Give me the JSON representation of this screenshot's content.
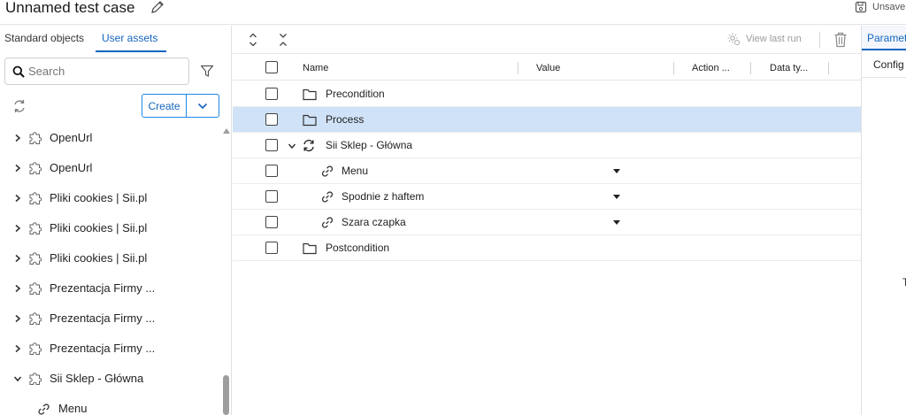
{
  "header": {
    "title": "Unnamed test case",
    "unsaved_label": "Unsave"
  },
  "left_panel": {
    "tabs": [
      {
        "label": "Standard objects",
        "active": false
      },
      {
        "label": "User assets",
        "active": true
      }
    ],
    "search": {
      "placeholder": "Search",
      "value": ""
    },
    "create_label": "Create",
    "tree": [
      {
        "label": "OpenUrl",
        "expanded": false,
        "child": false
      },
      {
        "label": "OpenUrl",
        "expanded": false,
        "child": false
      },
      {
        "label": "Pliki cookies | Sii.pl",
        "expanded": false,
        "child": false
      },
      {
        "label": "Pliki cookies | Sii.pl",
        "expanded": false,
        "child": false
      },
      {
        "label": "Pliki cookies | Sii.pl",
        "expanded": false,
        "child": false
      },
      {
        "label": "Prezentacja Firmy ...",
        "expanded": false,
        "child": false
      },
      {
        "label": "Prezentacja Firmy ...",
        "expanded": false,
        "child": false
      },
      {
        "label": "Prezentacja Firmy ...",
        "expanded": false,
        "child": false
      },
      {
        "label": "Sii Sklep - Główna",
        "expanded": true,
        "child": false
      },
      {
        "label": "Menu",
        "expanded": false,
        "child": true
      }
    ]
  },
  "main": {
    "toolbar": {
      "view_last_run": "View last run"
    },
    "columns": [
      "Name",
      "Value",
      "Action ...",
      "Data ty..."
    ],
    "rows": [
      {
        "name": "Precondition",
        "icon": "folder-icon",
        "selected": false,
        "level": 0
      },
      {
        "name": "Process",
        "icon": "folder-icon",
        "selected": true,
        "level": 0
      },
      {
        "name": "Sii Sklep - Główna",
        "icon": "sync-icon",
        "selected": false,
        "level": 0,
        "expanded": true
      },
      {
        "name": "Menu",
        "icon": "link-icon",
        "selected": false,
        "level": 1,
        "has_value_dropdown": true
      },
      {
        "name": "Spodnie z haftem",
        "icon": "link-icon",
        "selected": false,
        "level": 1,
        "has_value_dropdown": true
      },
      {
        "name": "Szara czapka",
        "icon": "link-icon",
        "selected": false,
        "level": 1,
        "has_value_dropdown": true
      },
      {
        "name": "Postcondition",
        "icon": "folder-icon",
        "selected": false,
        "level": 0
      }
    ]
  },
  "right_panel": {
    "tab_label": "Paramet",
    "config_label": "Config",
    "partial_text": "T"
  },
  "colors": {
    "accent": "#1565c0",
    "selected_row": "#cfe2f7"
  }
}
